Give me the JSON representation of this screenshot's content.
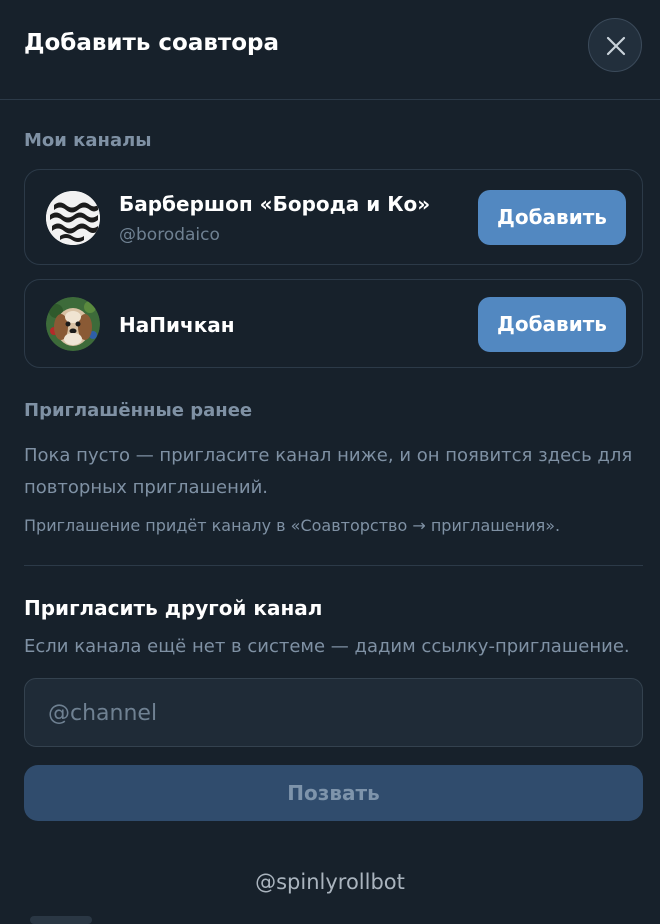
{
  "header": {
    "title": "Добавить соавтора"
  },
  "my_channels": {
    "label": "Мои каналы",
    "items": [
      {
        "name": "Барбершоп «Борода и Ко»",
        "handle": "@borodaico",
        "button": "Добавить"
      },
      {
        "name": "НаПичкан",
        "button": "Добавить"
      }
    ]
  },
  "invited": {
    "label": "Приглашённые ранее",
    "empty_text": "Пока пусто — пригласите канал ниже, и он появится здесь для повторных приглашений.",
    "note": "Приглашение придёт каналу в «Соавторство → приглашения»."
  },
  "invite": {
    "title": "Пригласить другой канал",
    "hint": "Если канала ещё нет в системе — дадим ссылку-приглашение.",
    "placeholder": "@channel",
    "value": "",
    "submit_label": "Позвать"
  },
  "footer": {
    "bot": "@spinlyrollbot"
  },
  "colors": {
    "background": "#17212b",
    "accent": "#5288c1",
    "disabled_button": "#304c6d"
  }
}
